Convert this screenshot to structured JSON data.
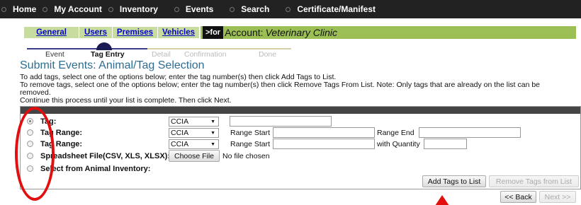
{
  "topnav": {
    "items": [
      {
        "label": "Home"
      },
      {
        "label": "My Account"
      },
      {
        "label": "Inventory"
      },
      {
        "label": "Events"
      },
      {
        "label": "Search"
      },
      {
        "label": "Certificate/Manifest"
      }
    ]
  },
  "subnav": {
    "tabs": [
      {
        "label": "General"
      },
      {
        "label": "Users"
      },
      {
        "label": "Premises"
      },
      {
        "label": "Vehicles"
      }
    ],
    "for_label": ">for",
    "account_label": "Account:",
    "account_name": "Veterinary Clinic"
  },
  "steps": [
    {
      "label": "Event"
    },
    {
      "label": "Tag Entry"
    },
    {
      "label": "Detail"
    },
    {
      "label": "Confirmation"
    },
    {
      "label": "Done"
    }
  ],
  "page_title": "Submit Events: Animal/Tag Selection",
  "instructions": [
    "To add tags, select one of the options below; enter the tag number(s) then click Add Tags to List.",
    "To remove tags, select one of the options below; enter the tag number(s) then click Remove Tags From List. Note: Only tags that are already on the list can be",
    "removed.",
    "Continue this process until your list is complete. Then click Next."
  ],
  "form": {
    "rows": [
      {
        "label": "Tag:",
        "select": "CCIA"
      },
      {
        "label": "Tag Range:",
        "select": "CCIA",
        "range_start_label": "Range Start",
        "range_end_label": "Range End"
      },
      {
        "label": "Tag Range:",
        "select": "CCIA",
        "range_start_label": "Range Start",
        "quantity_label": "with Quantity"
      },
      {
        "label": "Spreadsheet File(CSV, XLS, XLSX):",
        "file_button": "Choose File",
        "file_status": "No file chosen"
      },
      {
        "label": "Select from Animal Inventory:"
      }
    ],
    "add_button": "Add Tags to List",
    "remove_button": "Remove Tags from List"
  },
  "nav_buttons": {
    "back": "<< Back",
    "next": "Next >>"
  },
  "colors": {
    "topnav_bg": "#222222",
    "subnav_bg": "#9bbf55",
    "title": "#2c6e93",
    "annotation": "#e30e0e"
  }
}
